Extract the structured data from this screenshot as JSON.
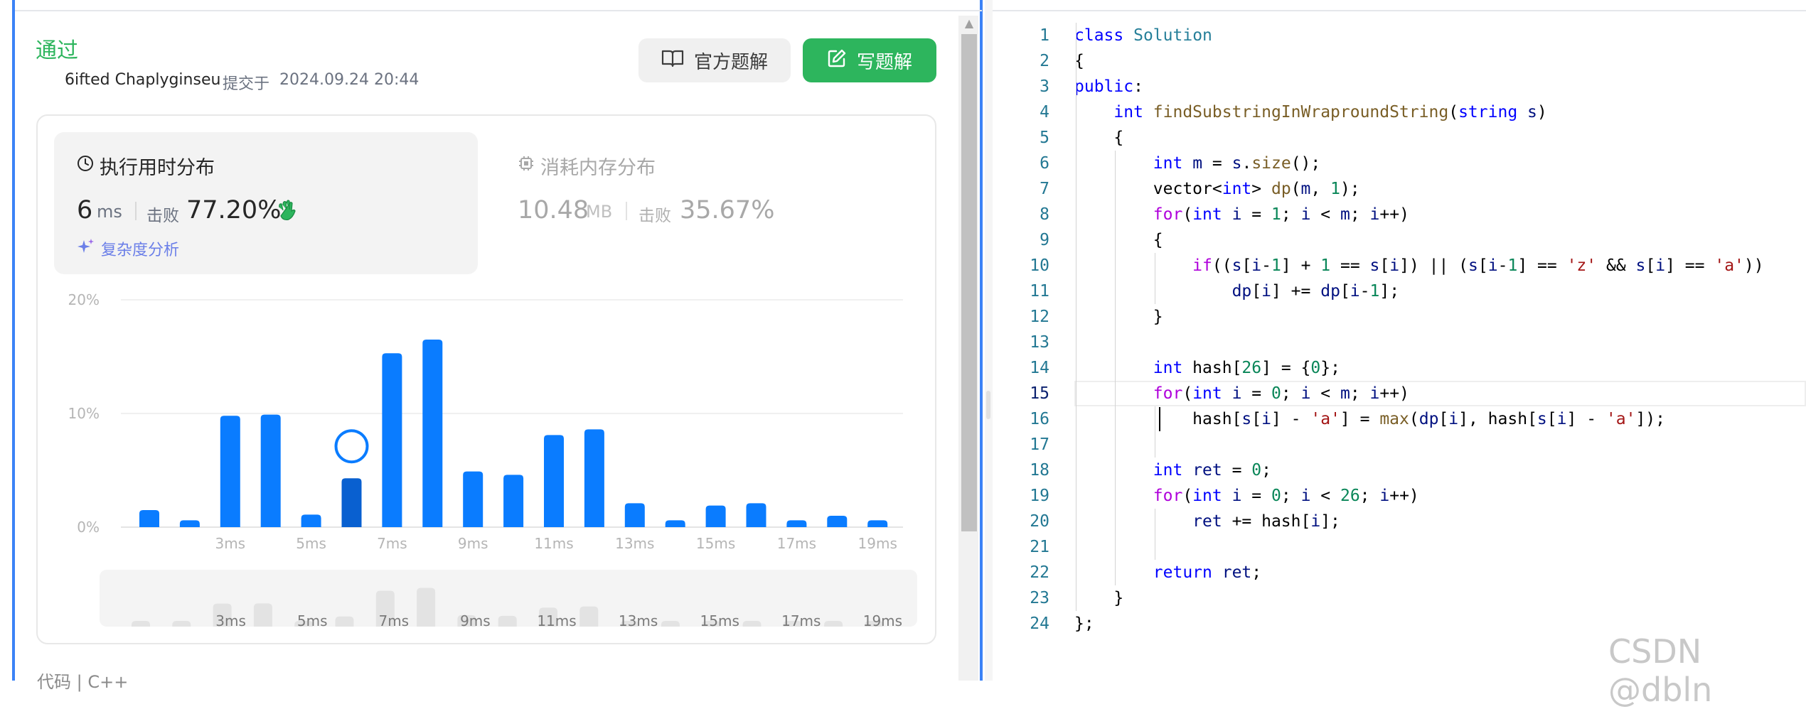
{
  "result": {
    "status": "通过",
    "author": "6ifted Chaplyginseu",
    "submitted_prefix": "提交于",
    "submitted_time": "2024.09.24 20:44",
    "buttons": {
      "official": "官方题解",
      "write": "写题解"
    }
  },
  "runtime": {
    "title": "执行用时分布",
    "value": "6",
    "unit": "ms",
    "beat_label": "击败",
    "beat": "77.20%",
    "complexity_link": "复杂度分析"
  },
  "memory": {
    "title": "消耗内存分布",
    "value": "10.48",
    "unit": "MB",
    "beat_label": "击败",
    "beat": "35.67%"
  },
  "chart_data": {
    "type": "bar",
    "title": "",
    "xlabel": "",
    "ylabel": "",
    "ylim": [
      0,
      20
    ],
    "y_ticks": [
      "0%",
      "10%",
      "20%"
    ],
    "x_tick_labels": [
      "3ms",
      "5ms",
      "7ms",
      "9ms",
      "11ms",
      "13ms",
      "15ms",
      "17ms",
      "19ms"
    ],
    "x": [
      1,
      2,
      3,
      4,
      5,
      6,
      7,
      8,
      9,
      10,
      11,
      12,
      13,
      14,
      15,
      16,
      17,
      18,
      19
    ],
    "values": [
      1.5,
      0.6,
      9.8,
      9.9,
      1.1,
      4.3,
      15.3,
      16.5,
      4.9,
      4.6,
      8.1,
      8.6,
      2.1,
      0.6,
      1.9,
      2.1,
      0.6,
      1.0,
      0.6
    ],
    "highlight_x": 6,
    "grid": true,
    "colors": {
      "bar": "#0a7cff",
      "highlight": "#0960d0",
      "mini_bar": "#e3e3e3"
    }
  },
  "mini_chart": {
    "labels": [
      "3ms",
      "5ms",
      "7ms",
      "9ms",
      "11ms",
      "13ms",
      "15ms",
      "17ms",
      "19ms"
    ]
  },
  "bottom_text": "代码 | C++",
  "editor": {
    "active_line": 15,
    "lines": [
      "class Solution",
      "{",
      "public:",
      "    int findSubstringInWraproundString(string s)",
      "    {",
      "        int m = s.size();",
      "        vector<int> dp(m, 1);",
      "        for(int i = 1; i < m; i++)",
      "        {",
      "            if((s[i-1] + 1 == s[i]) || (s[i-1] == 'z' && s[i] == 'a'))",
      "                dp[i] += dp[i-1];",
      "        }",
      "",
      "        int hash[26] = {0};",
      "        for(int i = 0; i < m; i++)",
      "            hash[s[i] - 'a'] = max(dp[i], hash[s[i] - 'a']);",
      "",
      "        int ret = 0;",
      "        for(int i = 0; i < 26; i++)",
      "            ret += hash[i];",
      "",
      "        return ret;",
      "    }",
      "};"
    ]
  },
  "watermark": "CSDN @dbln"
}
